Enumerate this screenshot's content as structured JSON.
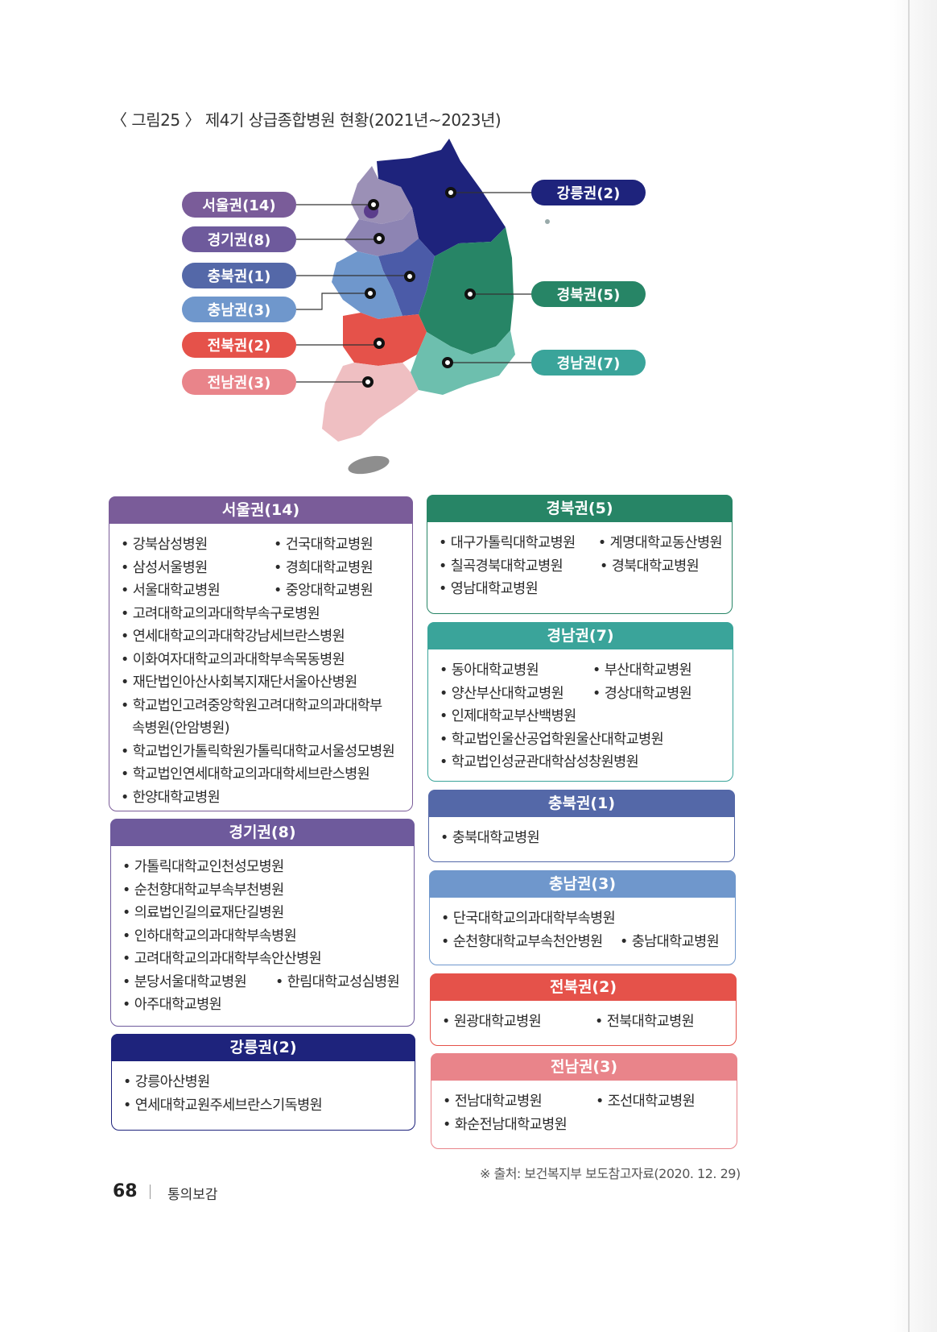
{
  "caption": "〈 그림25 〉 제4기 상급종합병원 현황(2021년~2023년)",
  "colors": {
    "seoul": "#7a5c99",
    "gyeonggi": "#6e5a9c",
    "chungbuk": "#5468a8",
    "chungnam": "#6f97cc",
    "jeonbuk": "#e5524a",
    "jeonnam": "#e9848a",
    "gangneung": "#1e237c",
    "gyeongbuk": "#278566",
    "gyeongnam": "#3aa49a"
  },
  "map_labels": {
    "seoul": "서울권(14)",
    "gyeonggi": "경기권(8)",
    "chungbuk": "충북권(1)",
    "chungnam": "충남권(3)",
    "jeonbuk": "전북권(2)",
    "jeonnam": "전남권(3)",
    "gangneung": "강릉권(2)",
    "gyeongbuk": "경북권(5)",
    "gyeongnam": "경남권(7)"
  },
  "regions": {
    "seoul": {
      "title": "서울권(14)",
      "pairs": [
        [
          "강북삼성병원",
          "건국대학교병원"
        ],
        [
          "삼성서울병원",
          "경희대학교병원"
        ],
        [
          "서울대학교병원",
          "중앙대학교병원"
        ]
      ],
      "items": [
        "고려대학교의과대학부속구로병원",
        "연세대학교의과대학강남세브란스병원",
        "이화여자대학교의과대학부속목동병원",
        "재단법인아산사회복지재단서울아산병원"
      ],
      "wrapped_line1": "학교법인고려중앙학원고려대학교의과대학부",
      "wrapped_line2": "속병원(안암병원)",
      "items2": [
        "학교법인가톨릭학원가톨릭대학교서울성모병원",
        "학교법인연세대학교의과대학세브란스병원",
        "한양대학교병원"
      ]
    },
    "gyeonggi": {
      "title": "경기권(8)",
      "items": [
        "가톨릭대학교인천성모병원",
        "순천향대학교부속부천병원",
        "의료법인길의료재단길병원",
        "인하대학교의과대학부속병원",
        "고려대학교의과대학부속안산병원"
      ],
      "pair": [
        "분당서울대학교병원",
        "한림대학교성심병원"
      ],
      "last": "아주대학교병원"
    },
    "gangneung": {
      "title": "강릉권(2)",
      "items": [
        "강릉아산병원",
        "연세대학교원주세브란스기독병원"
      ]
    },
    "gyeongbuk": {
      "title": "경북권(5)",
      "pairs": [
        [
          "대구가톨릭대학교병원",
          "계명대학교동산병원"
        ],
        [
          "칠곡경북대학교병원",
          "경북대학교병원"
        ]
      ],
      "last": "영남대학교병원"
    },
    "gyeongnam": {
      "title": "경남권(7)",
      "pairs": [
        [
          "동아대학교병원",
          "부산대학교병원"
        ],
        [
          "양산부산대학교병원",
          "경상대학교병원"
        ]
      ],
      "items": [
        "인제대학교부산백병원",
        "학교법인울산공업학원울산대학교병원",
        "학교법인성균관대학삼성창원병원"
      ]
    },
    "chungbuk": {
      "title": "충북권(1)",
      "items": [
        "충북대학교병원"
      ]
    },
    "chungnam": {
      "title": "충남권(3)",
      "first": "단국대학교의과대학부속병원",
      "pair": [
        "순천향대학교부속천안병원",
        "충남대학교병원"
      ]
    },
    "jeonbuk": {
      "title": "전북권(2)",
      "pair": [
        "원광대학교병원",
        "전북대학교병원"
      ]
    },
    "jeonnam": {
      "title": "전남권(3)",
      "pair": [
        "전남대학교병원",
        "조선대학교병원"
      ],
      "last": "화순전남대학교병원"
    }
  },
  "source": "※ 출처: 보건복지부 보도참고자료(2020. 12. 29)",
  "footer": {
    "page": "68",
    "book": "통의보감"
  }
}
